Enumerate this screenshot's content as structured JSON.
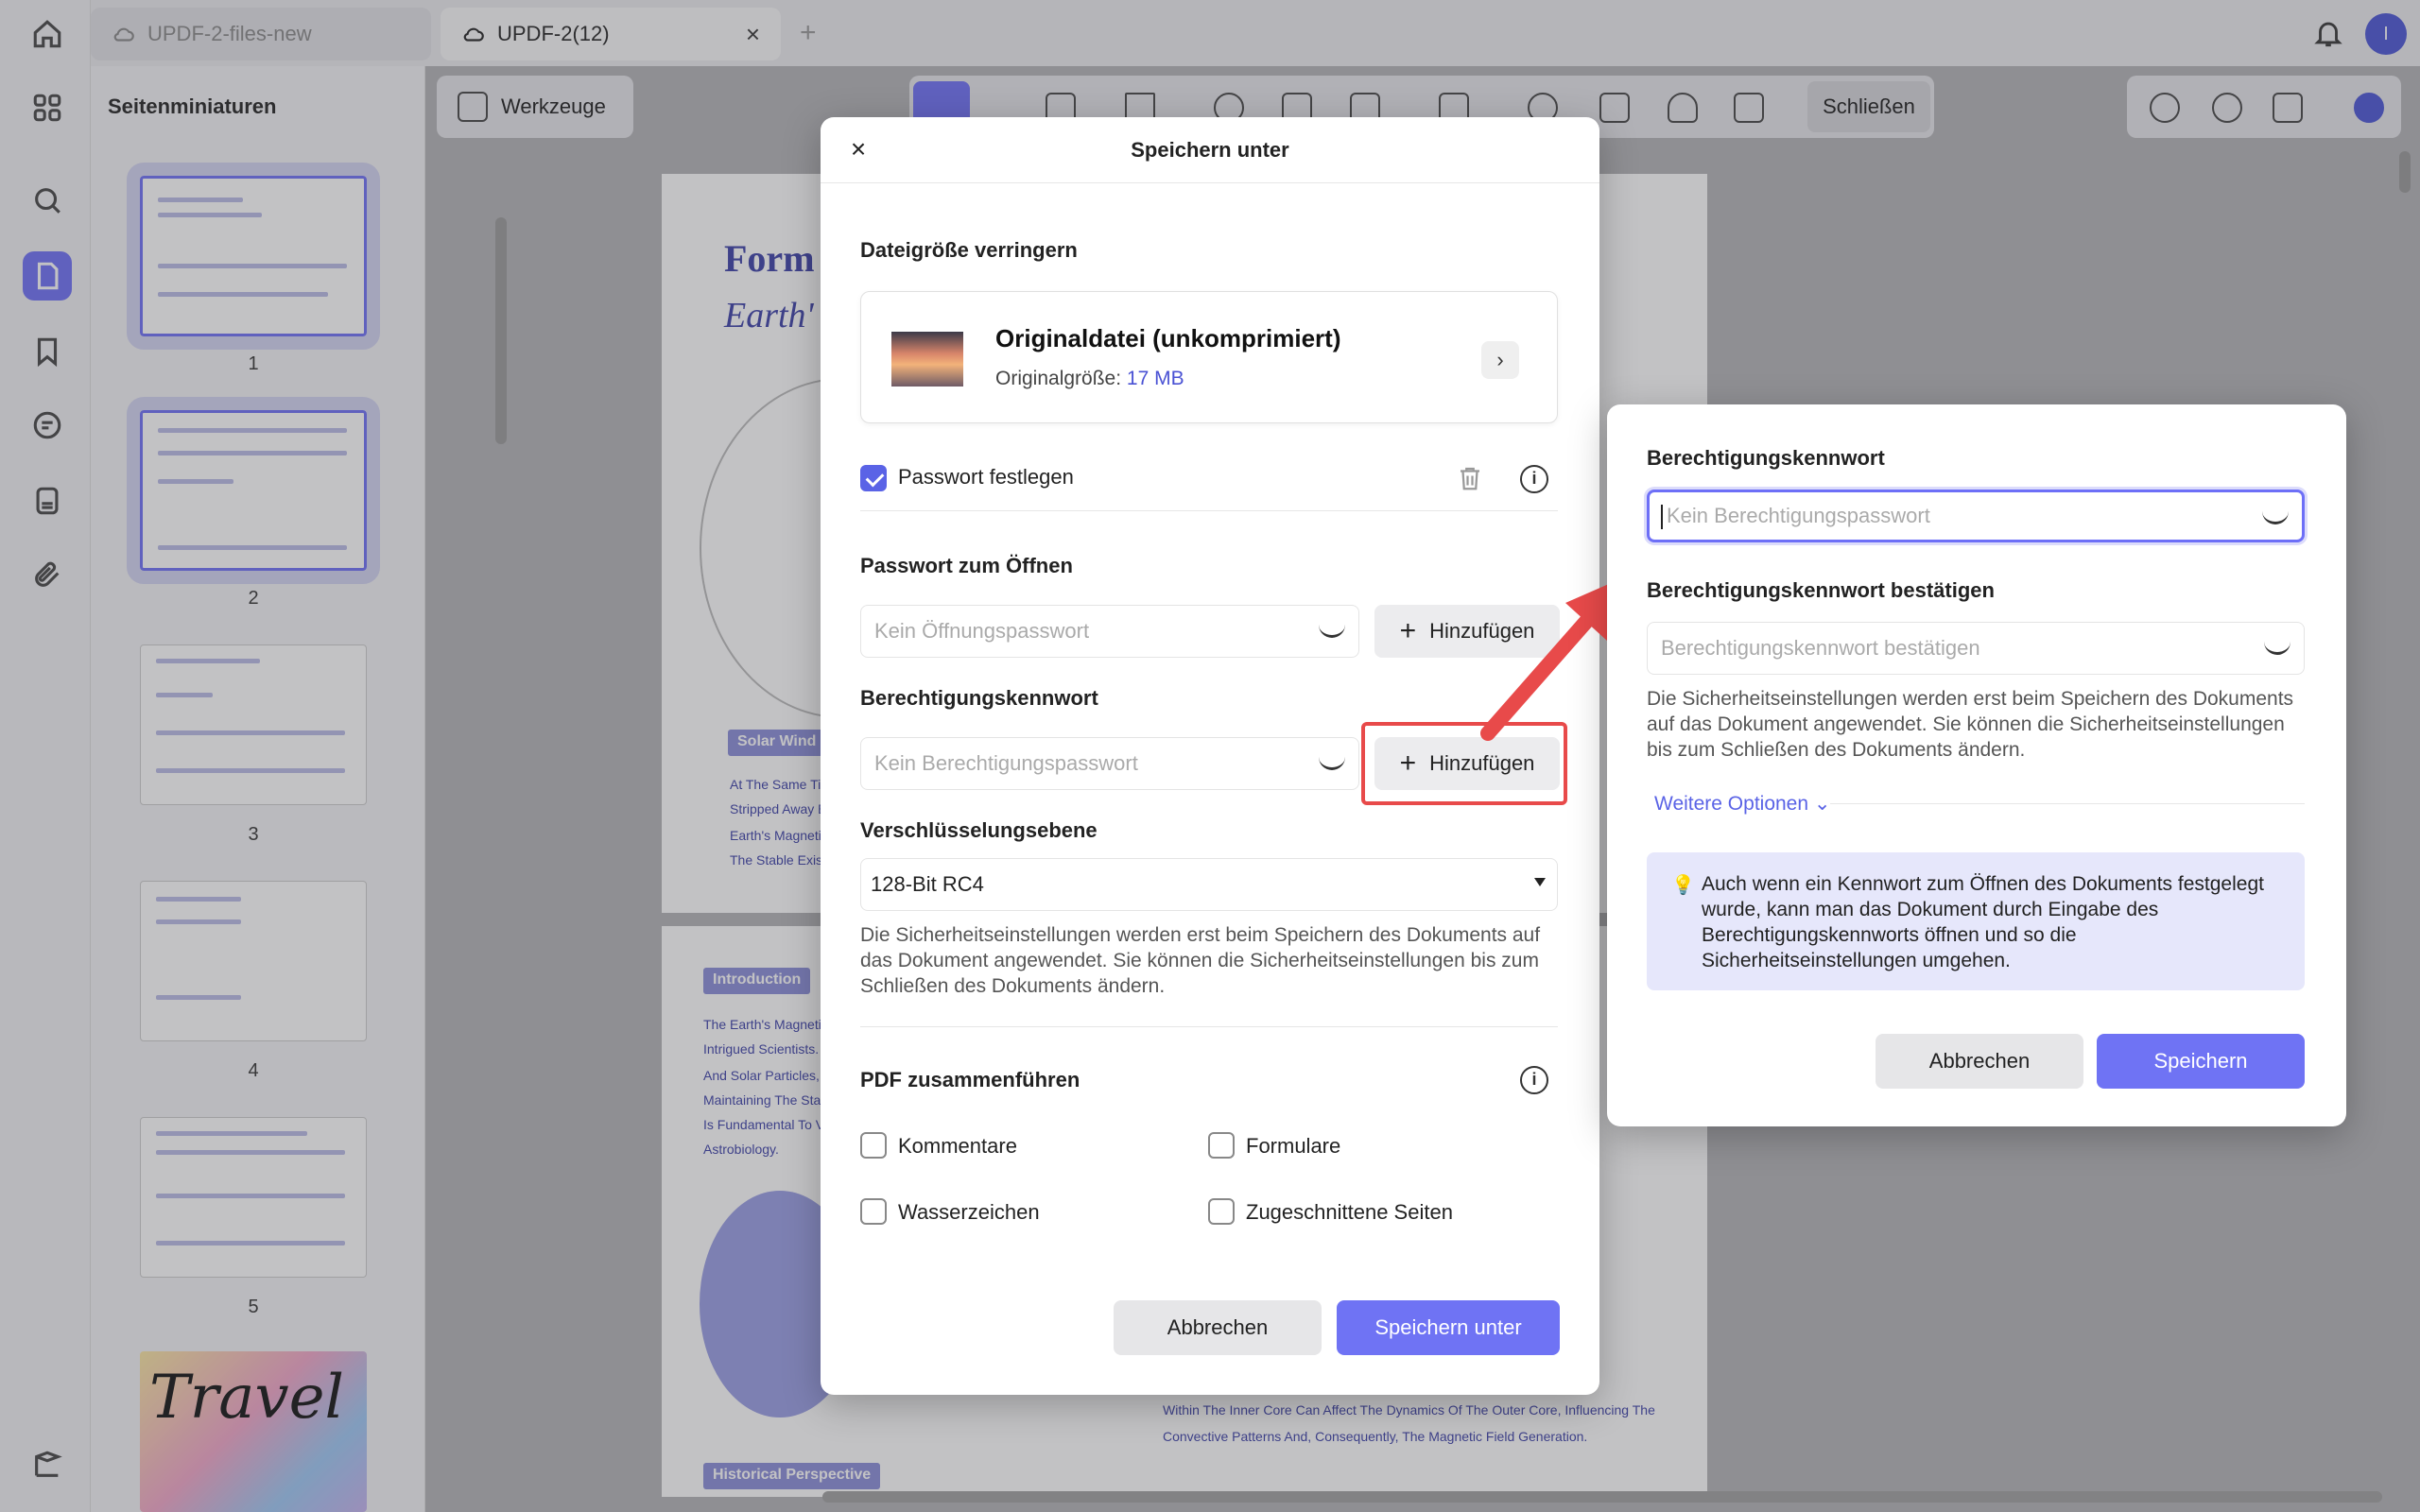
{
  "tabs": [
    {
      "label": "UPDF-2-files-new"
    },
    {
      "label": "UPDF-2(12)"
    }
  ],
  "user_initial": "I",
  "sidepanel": {
    "title": "Seitenminiaturen",
    "pages": [
      "1",
      "2",
      "3",
      "4",
      "5"
    ],
    "travel_text": "Travel"
  },
  "toolbar": {
    "tools_label": "Werkzeuge",
    "close_label": "Schließen"
  },
  "document": {
    "title_partial": "Form",
    "subtitle_partial": "Earth'",
    "tag_solar": "Solar Wind",
    "tag_intro": "Introduction",
    "tag_hist": "Historical Perspective",
    "lines": [
      "At The Same Tim",
      "Stripped Away By",
      "Earth's Magnetic",
      "The Stable Existe"
    ],
    "intro_lines": [
      "The Earth's Magnetic",
      "Intrigued Scientists. It",
      "And Solar Particles, Pl",
      "Maintaining The Stabil",
      "Is Fundamental To Va",
      "Astrobiology."
    ],
    "bottom_lines": [
      "Within The Inner Core Can Affect The Dynamics Of The Outer Core, Influencing The",
      "Convective Patterns And, Consequently, The Magnetic Field Generation."
    ]
  },
  "dialog": {
    "title": "Speichern unter",
    "reduce_label": "Dateigröße verringern",
    "file_title": "Originaldatei (unkomprimiert)",
    "file_size_label": "Originalgröße:",
    "file_size_value": "17 MB",
    "set_password_label": "Passwort festlegen",
    "open_pw_label": "Passwort zum Öffnen",
    "open_pw_placeholder": "Kein Öffnungspasswort",
    "add_label": "Hinzufügen",
    "perm_pw_label": "Berechtigungskennwort",
    "perm_pw_placeholder": "Kein Berechtigungspasswort",
    "encryption_label": "Verschlüsselungsebene",
    "encryption_value": "128-Bit RC4",
    "security_note": "Die Sicherheitseinstellungen werden erst beim Speichern des Dokuments auf das Dokument angewendet. Sie können die Sicherheitseinstellungen bis zum Schließen des Dokuments ändern.",
    "merge_label": "PDF zusammenführen",
    "merge_options": [
      "Kommentare",
      "Formulare",
      "Wasserzeichen",
      "Zugeschnittene Seiten"
    ],
    "cancel_label": "Abbrechen",
    "save_as_label": "Speichern unter"
  },
  "popup": {
    "perm_label": "Berechtigungskennwort",
    "perm_placeholder": "Kein Berechtigungspasswort",
    "confirm_label": "Berechtigungskennwort bestätigen",
    "confirm_placeholder": "Berechtigungskennwort bestätigen",
    "note": "Die Sicherheitseinstellungen werden erst beim Speichern des Dokuments auf das Dokument angewendet. Sie können die Sicherheitseinstellungen bis zum Schließen des Dokuments ändern.",
    "more_options": "Weitere Optionen",
    "tip": "Auch wenn ein Kennwort zum Öffnen des Dokuments festgelegt wurde, kann man das Dokument durch Eingabe des Berechtigungskennworts öffnen und so die Sicherheitseinstellungen umgehen.",
    "cancel_label": "Abbrechen",
    "save_label": "Speichern"
  },
  "colors": {
    "accent": "#6f73f4",
    "highlight_red": "#e84a4a"
  }
}
